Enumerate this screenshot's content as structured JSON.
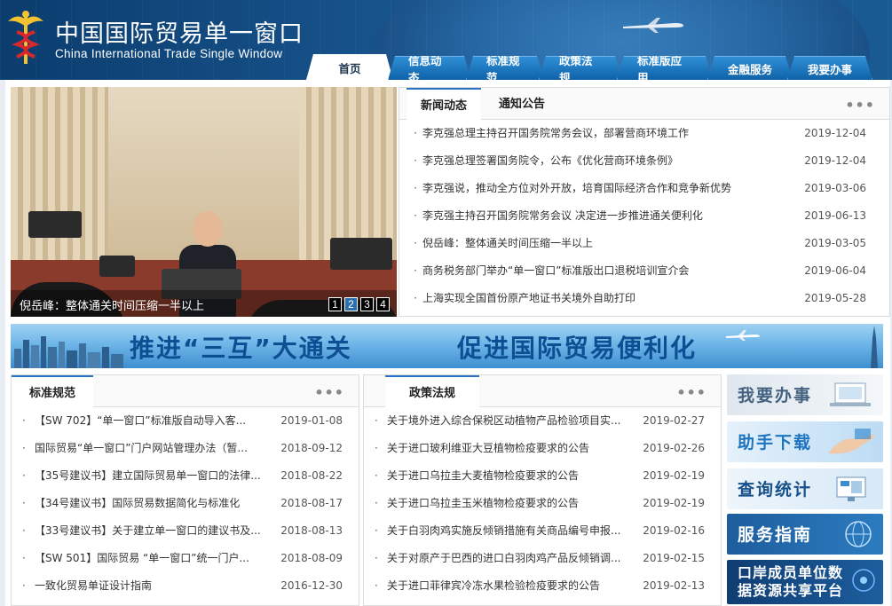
{
  "header": {
    "title": "中国国际贸易单一窗口",
    "subtitle": "China International Trade Single  Window"
  },
  "nav": {
    "tabs": [
      "首页",
      "信息动态",
      "标准规范",
      "政策法规",
      "标准版应用",
      "金融服务",
      "我要办事"
    ],
    "active_index": 0
  },
  "slideshow": {
    "caption": "倪岳峰：整体通关时间压缩一半以上",
    "pages": [
      "1",
      "2",
      "3",
      "4"
    ],
    "active_page": 1
  },
  "news": {
    "tabs": [
      "新闻动态",
      "通知公告"
    ],
    "more": "•••",
    "items": [
      {
        "title": "李克强总理主持召开国务院常务会议，部署营商环境工作",
        "date": "2019-12-04"
      },
      {
        "title": "李克强总理签署国务院令，公布《优化营商环境条例》",
        "date": "2019-12-04"
      },
      {
        "title": "李克强说，推动全方位对外开放，培育国际经济合作和竞争新优势",
        "date": "2019-03-06"
      },
      {
        "title": "李克强主持召开国务院常务会议 决定进一步推进通关便利化",
        "date": "2019-06-13"
      },
      {
        "title": "倪岳峰：整体通关时间压缩一半以上",
        "date": "2019-03-05"
      },
      {
        "title": "商务税务部门举办“单一窗口”标准版出口退税培训宣介会",
        "date": "2019-06-04"
      },
      {
        "title": "上海实现全国首份原产地证书关境外自助打印",
        "date": "2019-05-28"
      }
    ]
  },
  "banner": {
    "text_left": "推进“三互”大通关",
    "text_right": "促进国际贸易便利化"
  },
  "standards": {
    "title": "标准规范",
    "more": "•••",
    "items": [
      {
        "title": "【SW 702】“单一窗口”标准版自动导入客...",
        "date": "2019-01-08"
      },
      {
        "title": "国际贸易“单一窗口”门户网站管理办法（暂...",
        "date": "2018-09-12"
      },
      {
        "title": "【35号建议书】建立国际贸易单一窗口的法律...",
        "date": "2018-08-22"
      },
      {
        "title": "【34号建议书】国际贸易数据简化与标准化",
        "date": "2018-08-17"
      },
      {
        "title": "【33号建议书】关于建立单一窗口的建议书及...",
        "date": "2018-08-13"
      },
      {
        "title": "【SW 501】国际贸易 “单一窗口”统一门户...",
        "date": "2018-08-09"
      },
      {
        "title": "一致化贸易单证设计指南",
        "date": "2016-12-30"
      }
    ]
  },
  "policies": {
    "title": "政策法规",
    "more": "•••",
    "items": [
      {
        "title": "关于境外进入综合保税区动植物产品检验项目实...",
        "date": "2019-02-27"
      },
      {
        "title": "关于进口玻利维亚大豆植物检疫要求的公告",
        "date": "2019-02-26"
      },
      {
        "title": "关于进口乌拉圭大麦植物检疫要求的公告",
        "date": "2019-02-19"
      },
      {
        "title": "关于进口乌拉圭玉米植物检疫要求的公告",
        "date": "2019-02-19"
      },
      {
        "title": "关于白羽肉鸡实施反倾销措施有关商品编号申报...",
        "date": "2019-02-16"
      },
      {
        "title": "关于对原产于巴西的进口白羽肉鸡产品反倾销调...",
        "date": "2019-02-15"
      },
      {
        "title": "关于进口菲律宾冷冻水果检验检疫要求的公告",
        "date": "2019-02-13"
      }
    ]
  },
  "quick_links": {
    "items": [
      "我要办事",
      "助手下载",
      "查询统计",
      "服务指南",
      "口岸成员单位数据资源共享平台"
    ],
    "last_line1": "口岸成员单位数",
    "last_line2": "据资源共享平台"
  },
  "colors": {
    "header_bg": "#154f86",
    "tab_bg": "#0f62a8",
    "accent": "#2a72c2",
    "banner_text": "#0e4f93"
  }
}
